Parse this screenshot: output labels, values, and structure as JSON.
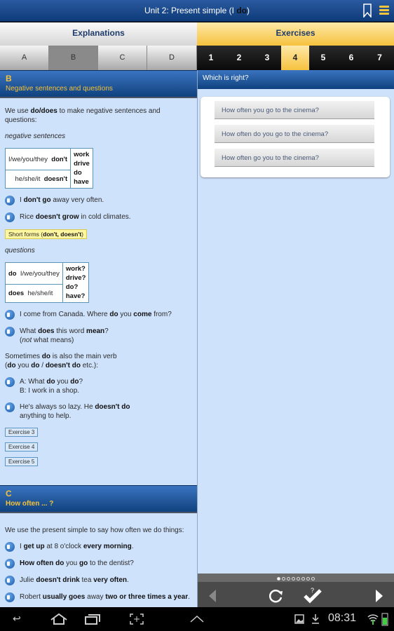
{
  "header": {
    "title_prefix": "Unit 2: Present simple (I ",
    "title_bold": "do",
    "title_suffix": ")",
    "bookmark_icon": "bookmark-icon",
    "menu_icon": "menu-icon"
  },
  "main_tabs": [
    {
      "label": "Explanations"
    },
    {
      "label": "Exercises",
      "selected": true
    }
  ],
  "section_tabs": [
    {
      "label": "A"
    },
    {
      "label": "B",
      "selected": true
    },
    {
      "label": "C"
    },
    {
      "label": "D"
    }
  ],
  "exercise_tabs": [
    {
      "label": "1"
    },
    {
      "label": "2"
    },
    {
      "label": "3"
    },
    {
      "label": "4",
      "selected": true
    },
    {
      "label": "5"
    },
    {
      "label": "6"
    },
    {
      "label": "7"
    }
  ],
  "section_b": {
    "letter": "B",
    "title": "Negative sentences and questions",
    "intro_pre": "We use ",
    "intro_bold": "do/does",
    "intro_post": " to make negative sentences and questions:",
    "neg_label": "negative sentences",
    "neg_table": {
      "rows": [
        [
          "I/we/you/they",
          "don't"
        ],
        [
          "he/she/it",
          "doesn't"
        ]
      ],
      "verbs": [
        "work",
        "drive",
        "do",
        "have"
      ]
    },
    "examples1": [
      {
        "pre": "I ",
        "bold": "don't go",
        "post": " away very often."
      },
      {
        "pre": "Rice ",
        "bold": "doesn't grow",
        "post": " in cold climates."
      }
    ],
    "short_forms": {
      "pre": "Short forms (",
      "bold": "don't, doesn't",
      "post": ")"
    },
    "q_label": "questions",
    "q_table": {
      "rows": [
        [
          "do",
          "I/we/you/they"
        ],
        [
          "does",
          "he/she/it"
        ]
      ],
      "verbs": [
        "work?",
        "drive?",
        "do?",
        "have?"
      ]
    },
    "ex2_1": "I come from Canada.  Where <b>do</b> you <b>come</b> from?",
    "ex2_2": "What <b>does</b> this word <b>mean</b>?<br>(<i>not</i> what means)",
    "main_verb": "Sometimes <b>do</b> is also the main verb<br>(<b>do</b> you <b>do</b> / <b>doesn't do</b> etc.):",
    "ex3_1": "A: What <b>do</b> you <b>do</b>?<br>B: I work in a shop.",
    "ex3_2": "He's always so lazy.  He <b>doesn't do</b><br>anything to help.",
    "exercise_links": [
      "Exercise 3",
      "Exercise 4",
      "Exercise 5"
    ]
  },
  "section_c": {
    "letter": "C",
    "title": "How often ... ?",
    "intro": "We use the present simple to say how often we do things:",
    "examples": [
      "I <b>get up</b> at 8 o'clock <b>every morning</b>.",
      "<b>How often do</b> you <b>go</b> to the dentist?",
      "Julie <b>doesn't drink</b> tea <b>very often</b>.",
      "Robert <b>usually goes</b> away <b>two or three times a year</b>."
    ]
  },
  "exercise": {
    "question": "Which is right?",
    "options": [
      "How often you go to the cinema?",
      "How often do you go to the cinema?",
      "How often go you to the cinema?"
    ],
    "page_dots": {
      "total": 8,
      "current": 1
    }
  },
  "system": {
    "time": "08:31"
  }
}
